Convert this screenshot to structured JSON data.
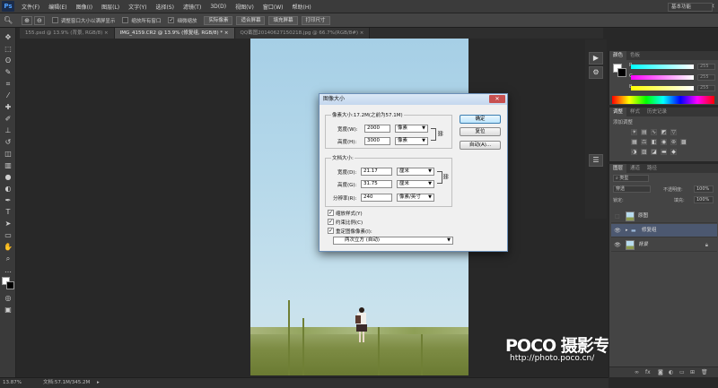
{
  "app": {
    "logo": "Ps"
  },
  "menu": [
    "文件(F)",
    "编辑(E)",
    "图像(I)",
    "图层(L)",
    "文字(Y)",
    "选择(S)",
    "滤镜(T)",
    "3D(D)",
    "视图(V)",
    "窗口(W)",
    "帮助(H)"
  ],
  "options": {
    "resize_windows": "调整窗口大小以满屏显示",
    "zoom_all": "缩放所有窗口",
    "scrubby_zoom": "细微缩放",
    "actual_pixels": "实际像素",
    "fit_screen": "适合屏幕",
    "fill_screen": "填充屏幕",
    "print_size": "打印尺寸",
    "workspace": "基本功能"
  },
  "tabs": [
    {
      "label": "155.psd @ 13.9% (背景, RGB/8) ×",
      "active": false
    },
    {
      "label": "IMG_4159.CR2 @ 13.9% (修复组, RGB/8) * ×",
      "active": true
    },
    {
      "label": "QQ截图20140627150218.jpg @ 66.7%(RGB/8#) ×",
      "active": false
    }
  ],
  "status": {
    "zoom": "13.87%",
    "doc": "文档:57.1M/345.2M"
  },
  "dialog": {
    "title": "图像大小",
    "pixel_dims": "像素大小:17.2M(之前为57.1M)",
    "width_label": "宽度(W):",
    "width_value": "2000",
    "width_unit": "像素",
    "height_label": "高度(H):",
    "height_value": "3000",
    "height_unit": "像素",
    "doc_size": "文档大小:",
    "doc_width_label": "宽度(D):",
    "doc_width_value": "21.17",
    "doc_width_unit": "厘米",
    "doc_height_label": "高度(G):",
    "doc_height_value": "31.75",
    "doc_height_unit": "厘米",
    "resolution_label": "分辨率(R):",
    "resolution_value": "240",
    "resolution_unit": "像素/英寸",
    "scale_styles": "缩放样式(Y)",
    "constrain": "约束比例(C)",
    "resample": "重定图像像素(I):",
    "resample_method": "两次立方 (自动)",
    "ok": "确定",
    "reset": "复位",
    "auto": "自动(A)..."
  },
  "color_panel": {
    "tabs": [
      "颜色",
      "色板"
    ],
    "values": [
      "255",
      "255",
      "255"
    ]
  },
  "adjust_panel": {
    "tabs": [
      "调整",
      "样式",
      "历史记录"
    ],
    "add_label": "添加调整"
  },
  "layers_panel": {
    "tabs": [
      "图层",
      "通道",
      "路径"
    ],
    "kind": "类型",
    "blend": "穿透",
    "opacity_label": "不透明度:",
    "opacity": "100%",
    "lock_label": "锁定:",
    "fill_label": "填充:",
    "fill": "100%",
    "layers": [
      {
        "name": "原图",
        "visible": false,
        "selected": false,
        "group": false
      },
      {
        "name": "修复组",
        "visible": true,
        "selected": true,
        "group": true
      },
      {
        "name": "背景",
        "visible": true,
        "selected": false,
        "group": false
      }
    ]
  },
  "watermark": {
    "brand": "POCO 摄影专题",
    "url": "http://photo.poco.cn/"
  }
}
